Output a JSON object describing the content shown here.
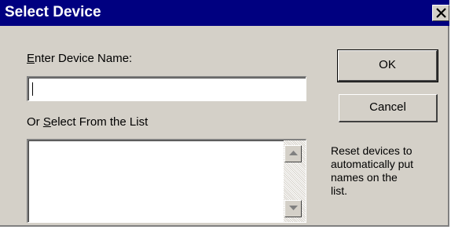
{
  "window": {
    "title": "Select Device",
    "close_glyph": "×"
  },
  "form": {
    "name_label": "Enter Device Name:",
    "name_value": "",
    "list_label": "Or Select From the List",
    "list_items": []
  },
  "buttons": {
    "ok_label": "OK",
    "cancel_label": "Cancel"
  },
  "help": {
    "lines": [
      "Reset devices to",
      "automatically put",
      "names on the",
      "list."
    ]
  },
  "icons": {
    "close": "close-icon",
    "scroll_up": "arrow-up-icon",
    "scroll_down": "arrow-down-icon"
  },
  "colors": {
    "titlebar": "#000080",
    "face": "#d4d0c8"
  }
}
